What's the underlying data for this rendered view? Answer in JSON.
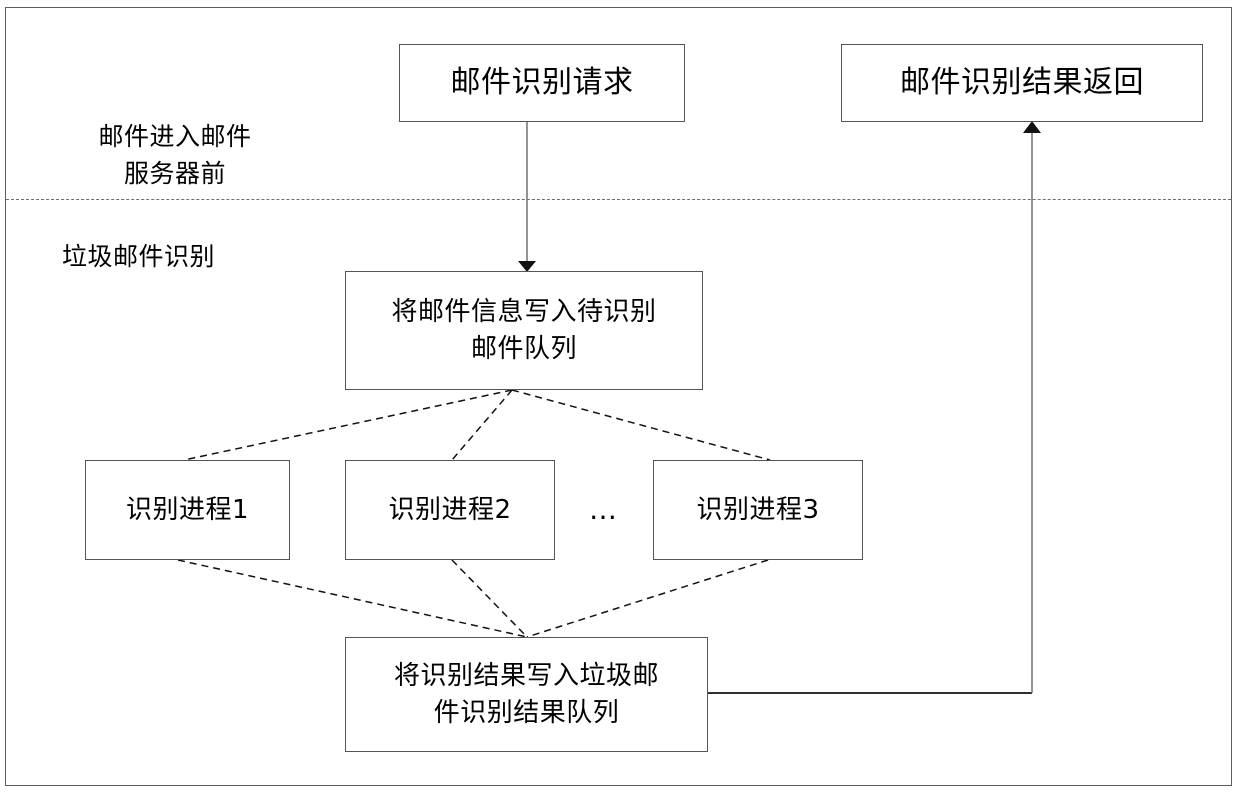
{
  "figure": {
    "title_text": "",
    "bands": [
      {
        "id": "before-mail-server",
        "label": "邮件进入邮件\n服务器前"
      },
      {
        "id": "spam-identification",
        "label": "垃圾邮件识别"
      }
    ],
    "nodes": {
      "mail_identify_request": "邮件识别请求",
      "mail_identify_result_return": "邮件识别结果返回",
      "write_mail_info_to_queue": "将邮件信息写入待识别\n邮件队列",
      "identify_process_1": "识别进程1",
      "identify_process_2": "识别进程2",
      "identify_process_3": "识别进程3",
      "write_result_to_queue": "将识别结果写入垃圾邮\n件识别结果队列"
    },
    "ellipsis": "…",
    "colors": {
      "frame": "#5d5d5d",
      "box_border": "#555555",
      "solid_connector": "#6b6b6b",
      "dashed_connector": "#1a1a1a",
      "text": "#000000",
      "background": "#ffffff"
    }
  }
}
